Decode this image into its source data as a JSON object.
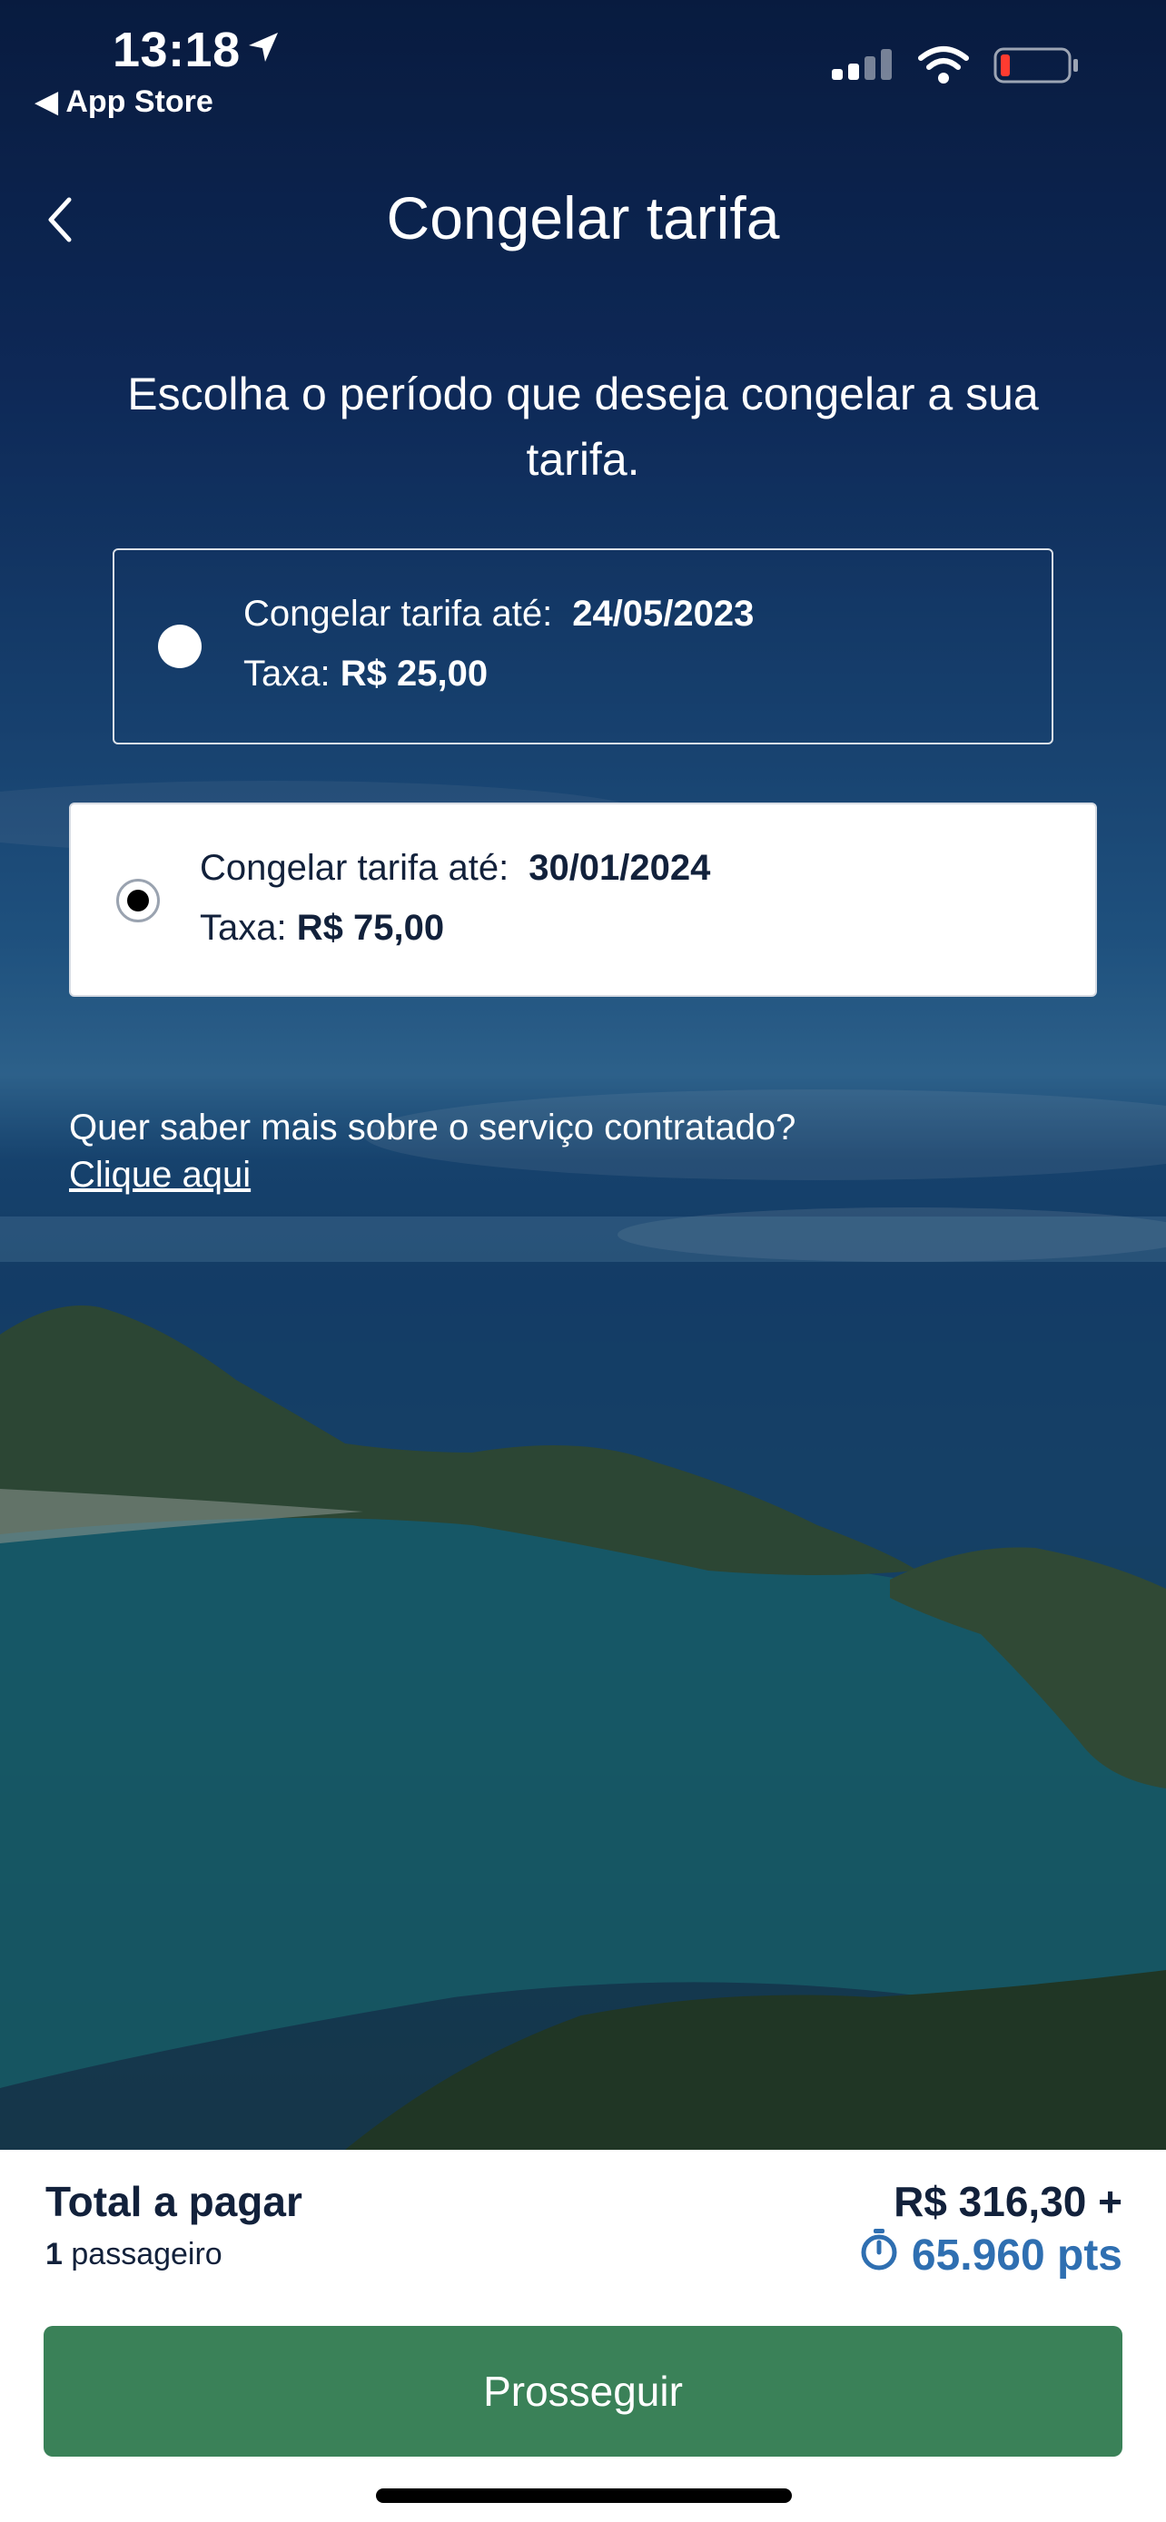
{
  "status": {
    "time": "13:18",
    "back_app": "◀ App Store"
  },
  "header": {
    "title": "Congelar tarifa"
  },
  "intro": "Escolha o período que deseja congelar a sua tarifa.",
  "options": [
    {
      "label": "Congelar tarifa até:",
      "date": "24/05/2023",
      "fee_label": "Taxa:",
      "fee_value": "R$ 25,00",
      "selected": false
    },
    {
      "label": "Congelar tarifa até:",
      "date": "30/01/2024",
      "fee_label": "Taxa:",
      "fee_value": "R$ 75,00",
      "selected": true
    }
  ],
  "info": {
    "question": "Quer saber mais sobre o serviço contratado?",
    "link": "Clique aqui"
  },
  "summary": {
    "total_label": "Total a pagar",
    "passenger_count": "1",
    "passenger_label": "passageiro",
    "price": "R$ 316,30 +",
    "points": "65.960 pts"
  },
  "cta": {
    "label": "Prosseguir"
  },
  "colors": {
    "accent_green": "#3a8158",
    "points_blue": "#2f6fb1",
    "text_dark": "#12213b"
  },
  "icons": {
    "back": "chevron-left-icon",
    "location": "location-arrow-icon",
    "signal": "signal-icon",
    "wifi": "wifi-icon",
    "battery": "battery-low-icon",
    "timer": "stopwatch-icon"
  }
}
